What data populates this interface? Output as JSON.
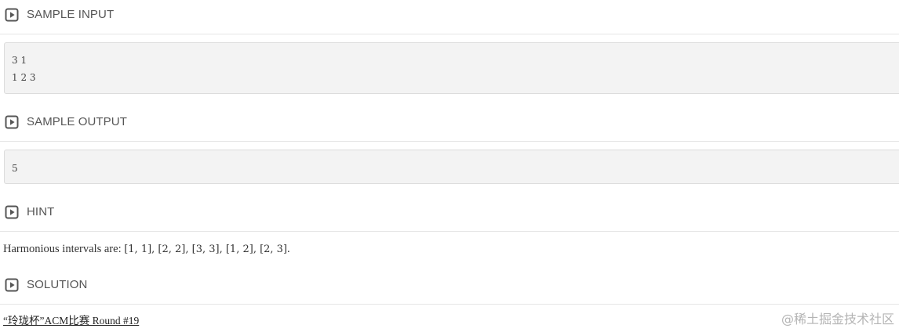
{
  "sections": {
    "sample_input": {
      "title": "SAMPLE INPUT",
      "lines": [
        "3 1",
        "1 2 3"
      ]
    },
    "sample_output": {
      "title": "SAMPLE OUTPUT",
      "lines": [
        "5"
      ]
    },
    "hint": {
      "title": "HINT",
      "prefix": "Harmonious intervals are: ",
      "intervals": "[1, 1], [2, 2], [3, 3], [1, 2], [2, 3]",
      "suffix": "."
    },
    "solution": {
      "title": "SOLUTION"
    }
  },
  "source_link": "“玲珑杯”ACM比赛 Round #19",
  "watermark": "@稀土掘金技术社区",
  "icons": {
    "section_toggle": "play-square-icon"
  },
  "colors": {
    "icon": "#555555",
    "code_background": "#f3f3f3",
    "divider": "#e6e6e6",
    "watermark": "#b4b4b4"
  }
}
